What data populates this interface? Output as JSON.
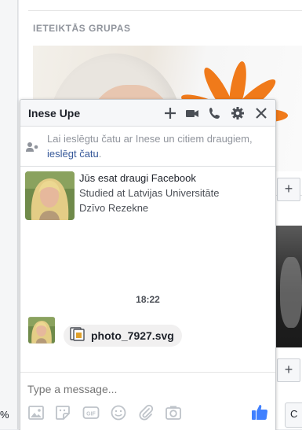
{
  "background": {
    "section_title": "IETEIKTĀS GRUPAS",
    "plus_label": "+",
    "partial_button": "C",
    "partial_pct": "%"
  },
  "chat": {
    "title": "Inese Upe",
    "header_icons": [
      "plus-icon",
      "video-icon",
      "phone-icon",
      "gear-icon",
      "close-icon"
    ],
    "notice_text": "Lai ieslēgtu čatu ar Inese un citiem draugiem,",
    "notice_link": "ieslēgt čatu",
    "notice_end": ".",
    "profile": {
      "line1": "Jūs esat draugi Facebook",
      "line2": "Studied at Latvijas Universitāte",
      "line3": "Dzīvo Rezekne"
    },
    "timestamp": "18:22",
    "attachment_name": "photo_7927.svg",
    "composer_placeholder": "Type a message...",
    "toolbar_icons": [
      "photo-icon",
      "sticker-icon",
      "gif-icon",
      "emoji-icon",
      "attachment-icon",
      "camera-icon",
      "like-icon"
    ],
    "accent_color": "#365899",
    "like_color": "#4080ff"
  }
}
